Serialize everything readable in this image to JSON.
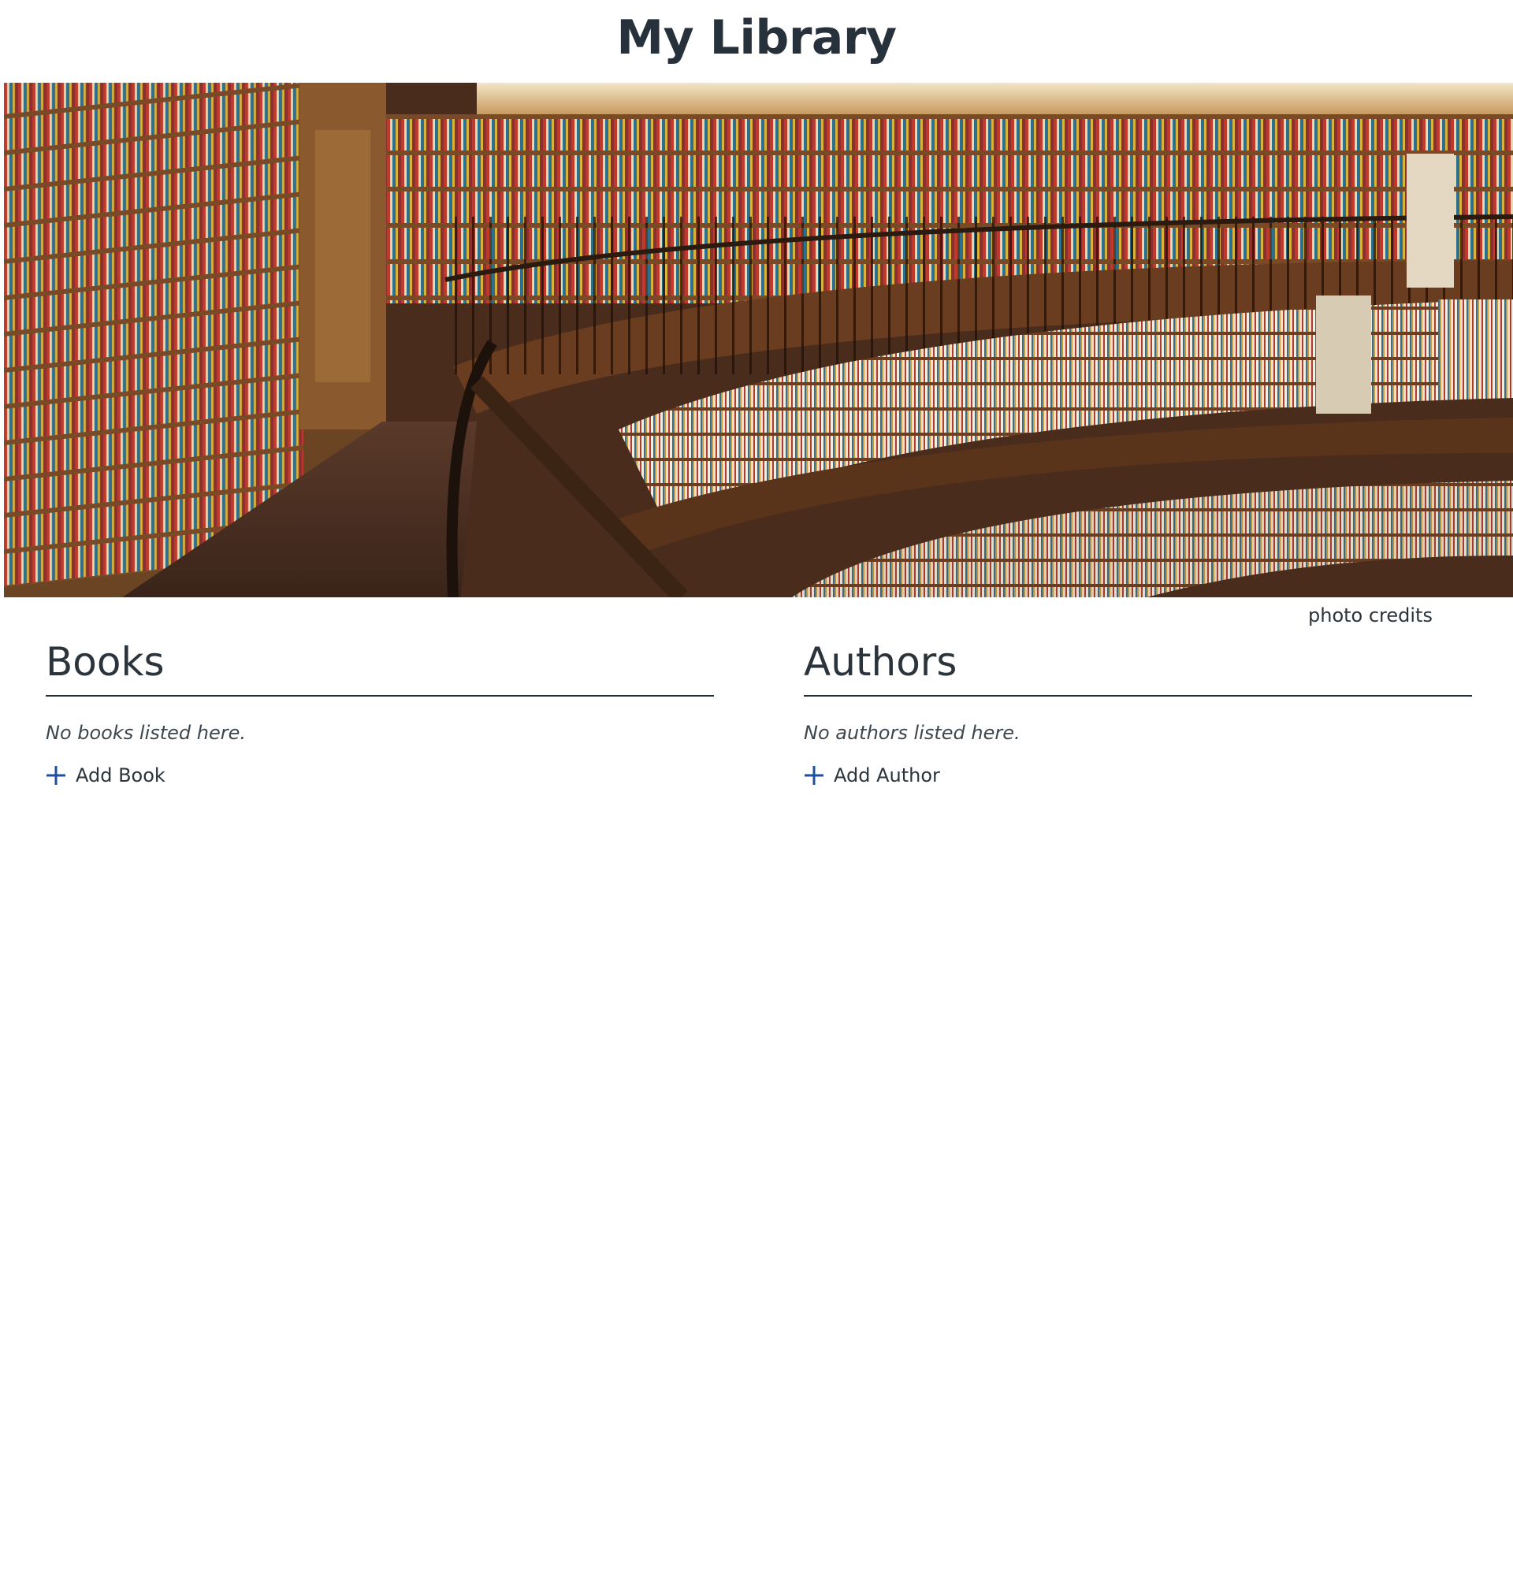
{
  "header": {
    "title": "My Library"
  },
  "hero": {
    "photo_credits_label": "photo credits"
  },
  "books": {
    "heading": "Books",
    "empty_message": "No books listed here.",
    "add_label": "Add Book",
    "add_icon": "plus-icon"
  },
  "authors": {
    "heading": "Authors",
    "empty_message": "No authors listed here.",
    "add_label": "Add Author",
    "add_icon": "plus-icon"
  },
  "colors": {
    "text": "#2b333b",
    "accent": "#1f4e9c",
    "rule": "#26313b"
  }
}
